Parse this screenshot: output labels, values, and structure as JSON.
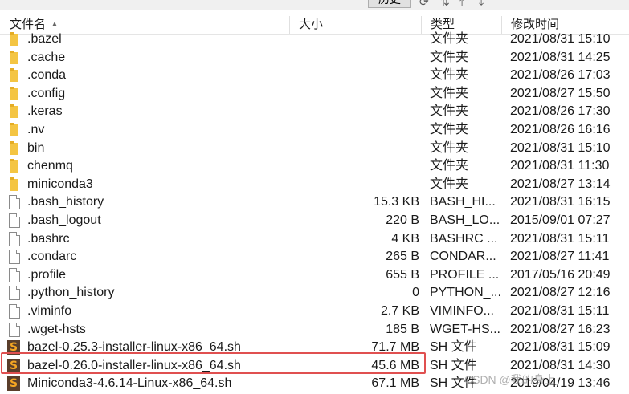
{
  "toolbar": {
    "history_label": "历史"
  },
  "columns": {
    "name": "文件名",
    "size": "大小",
    "type": "类型",
    "modified": "修改时间"
  },
  "rows": [
    {
      "name": ".bazel",
      "size": "",
      "type": "文件夹",
      "modified": "2021/08/31 15:10",
      "icon": "folder-icon"
    },
    {
      "name": ".cache",
      "size": "",
      "type": "文件夹",
      "modified": "2021/08/31 14:25",
      "icon": "folder-icon"
    },
    {
      "name": ".conda",
      "size": "",
      "type": "文件夹",
      "modified": "2021/08/26 17:03",
      "icon": "folder-icon"
    },
    {
      "name": ".config",
      "size": "",
      "type": "文件夹",
      "modified": "2021/08/27 15:50",
      "icon": "folder-icon"
    },
    {
      "name": ".keras",
      "size": "",
      "type": "文件夹",
      "modified": "2021/08/26 17:30",
      "icon": "folder-icon"
    },
    {
      "name": ".nv",
      "size": "",
      "type": "文件夹",
      "modified": "2021/08/26 16:16",
      "icon": "folder-icon"
    },
    {
      "name": "bin",
      "size": "",
      "type": "文件夹",
      "modified": "2021/08/31 15:10",
      "icon": "folder-icon"
    },
    {
      "name": "chenmq",
      "size": "",
      "type": "文件夹",
      "modified": "2021/08/31 11:30",
      "icon": "folder-icon"
    },
    {
      "name": "miniconda3",
      "size": "",
      "type": "文件夹",
      "modified": "2021/08/27 13:14",
      "icon": "folder-icon"
    },
    {
      "name": ".bash_history",
      "size": "15.3 KB",
      "type": "BASH_HI...",
      "modified": "2021/08/31 16:15",
      "icon": "file-icon"
    },
    {
      "name": ".bash_logout",
      "size": "220 B",
      "type": "BASH_LO...",
      "modified": "2015/09/01 07:27",
      "icon": "file-icon"
    },
    {
      "name": ".bashrc",
      "size": "4 KB",
      "type": "BASHRC ...",
      "modified": "2021/08/31 15:11",
      "icon": "file-icon"
    },
    {
      "name": ".condarc",
      "size": "265 B",
      "type": "CONDAR...",
      "modified": "2021/08/27 11:41",
      "icon": "file-icon"
    },
    {
      "name": ".profile",
      "size": "655 B",
      "type": "PROFILE ...",
      "modified": "2017/05/16 20:49",
      "icon": "file-icon"
    },
    {
      "name": ".python_history",
      "size": "0",
      "type": "PYTHON_...",
      "modified": "2021/08/27 12:16",
      "icon": "file-icon"
    },
    {
      "name": ".viminfo",
      "size": "2.7 KB",
      "type": "VIMINFO...",
      "modified": "2021/08/31 15:11",
      "icon": "file-icon"
    },
    {
      "name": ".wget-hsts",
      "size": "185 B",
      "type": "WGET-HS...",
      "modified": "2021/08/27 16:23",
      "icon": "file-icon"
    },
    {
      "name": "bazel-0.25.3-installer-linux-x86_64.sh",
      "size": "71.7 MB",
      "type": "SH 文件",
      "modified": "2021/08/31 15:09",
      "icon": "sh-file-icon"
    },
    {
      "name": "bazel-0.26.0-installer-linux-x86_64.sh",
      "size": "45.6 MB",
      "type": "SH 文件",
      "modified": "2021/08/31 14:30",
      "icon": "sh-file-icon"
    },
    {
      "name": "Miniconda3-4.6.14-Linux-x86_64.sh",
      "size": "67.1 MB",
      "type": "SH 文件",
      "modified": "2019/04/19 13:46",
      "icon": "sh-file-icon"
    }
  ],
  "highlighted_row": "bazel-0.26.0-installer-linux-x86_64.sh",
  "colors": {
    "highlight_border": "#e05050",
    "folder": "#f4c543"
  }
}
